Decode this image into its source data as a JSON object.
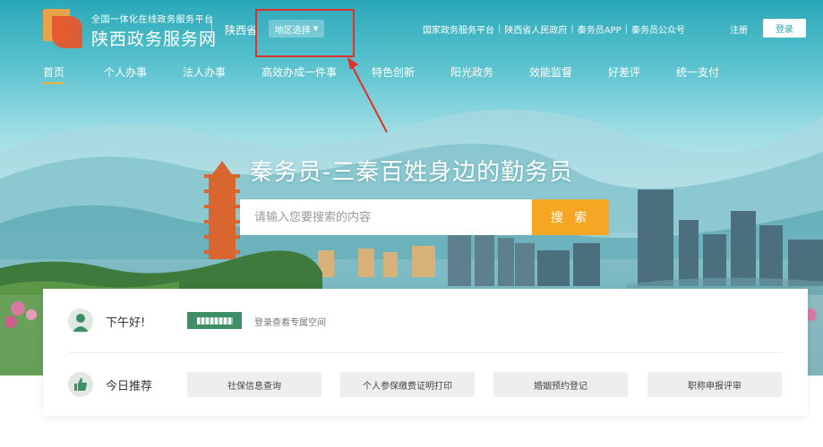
{
  "header": {
    "logo_sub": "全国一体化在线政务服务平台",
    "logo_title": "陕西政务服务网",
    "province": "陕西省",
    "region_select": "地区选择",
    "top_links": [
      "国家政务服务平台",
      "陕西省人民政府",
      "秦务员APP",
      "秦务员公众号"
    ],
    "register": "注册",
    "login": "登录"
  },
  "nav": {
    "items": [
      "首页",
      "个人办事",
      "法人办事",
      "高效办成一件事",
      "特色创新",
      "阳光政务",
      "效能监督",
      "好差评",
      "统一支付"
    ],
    "active_index": 0
  },
  "hero": {
    "slogan": "秦务员-三秦百姓身边的勤务员",
    "search_placeholder": "请输入您要搜索的内容",
    "search_button": "搜 索"
  },
  "user_panel": {
    "greeting": "下午好!",
    "login_hint": "登录查看专属空间",
    "recommend_label": "今日推荐",
    "recommend_items": [
      "社保信息查询",
      "个人参保缴费证明打印",
      "婚姻预约登记",
      "职称申报评审"
    ]
  },
  "colors": {
    "accent_orange": "#f5a623",
    "highlight_red": "#e0302a",
    "brand_green": "#3f8f66",
    "sky_teal": "#2aa8b8"
  }
}
